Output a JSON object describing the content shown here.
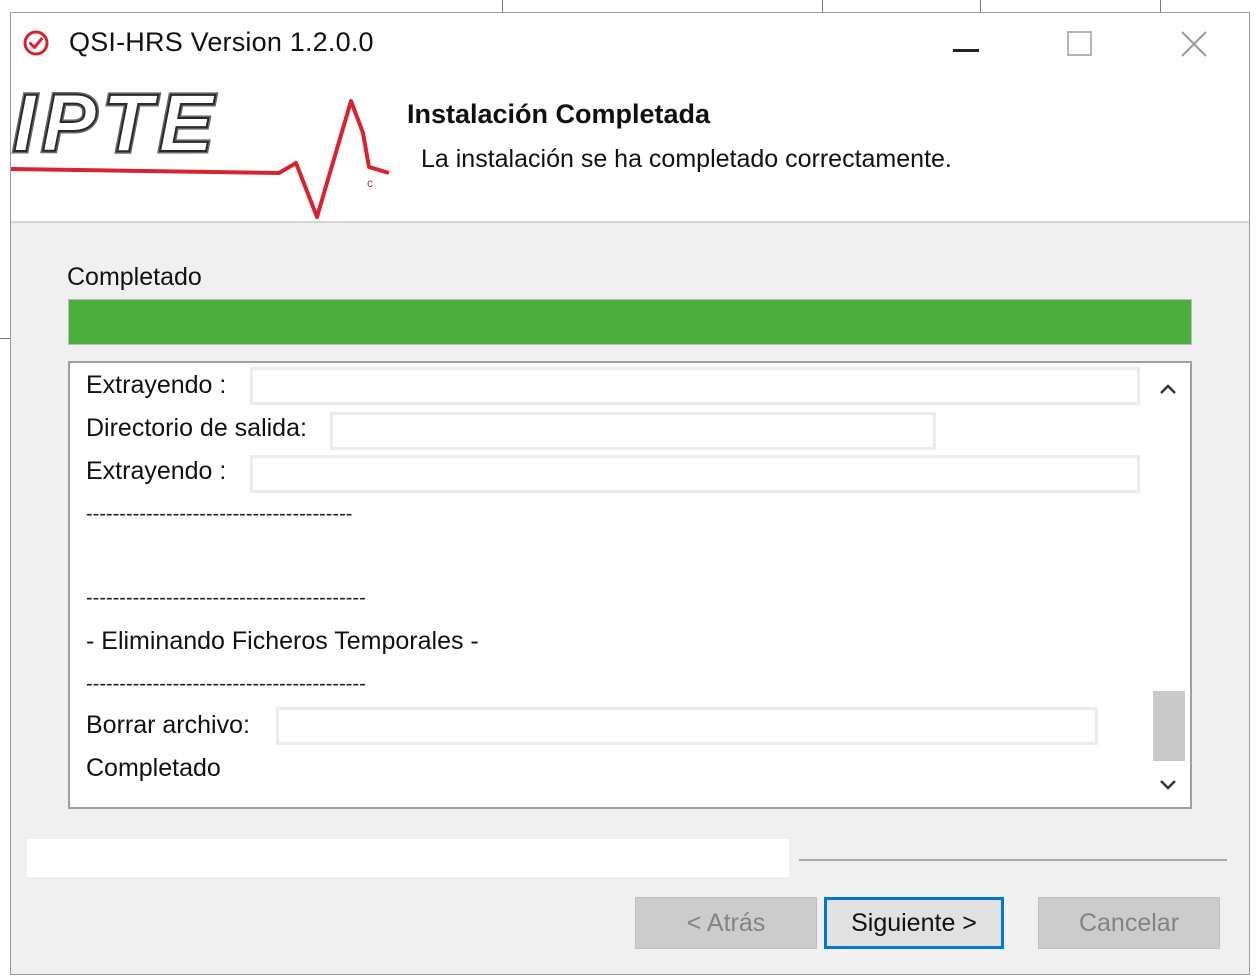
{
  "window": {
    "title": "QSI-HRS Version 1.2.0.0"
  },
  "header": {
    "logo_text": "IPTE",
    "title": "Instalación Completada",
    "subtitle": "La instalación se ha completado correctamente."
  },
  "progress": {
    "label": "Completado",
    "percent": 100,
    "color": "#4caf3d"
  },
  "log": {
    "lines": [
      "Extrayendo :",
      "Directorio de salida:",
      "Extrayendo :",
      "----------------------------------------",
      "",
      "------------------------------------------",
      "- Eliminando Ficheros Temporales -",
      "------------------------------------------",
      "Borrar archivo:",
      "Completado"
    ]
  },
  "buttons": {
    "back": "< Atrás",
    "next": "Siguiente >",
    "cancel": "Cancelar"
  },
  "icons": {
    "app": "check-circle-icon",
    "minimize": "minimize-icon",
    "maximize": "maximize-icon",
    "close": "close-icon",
    "scroll_up": "chevron-up-icon",
    "scroll_down": "chevron-down-icon"
  },
  "colors": {
    "accent": "#0078d7",
    "brand_red": "#d9232e",
    "progress_green": "#4caf3d"
  }
}
